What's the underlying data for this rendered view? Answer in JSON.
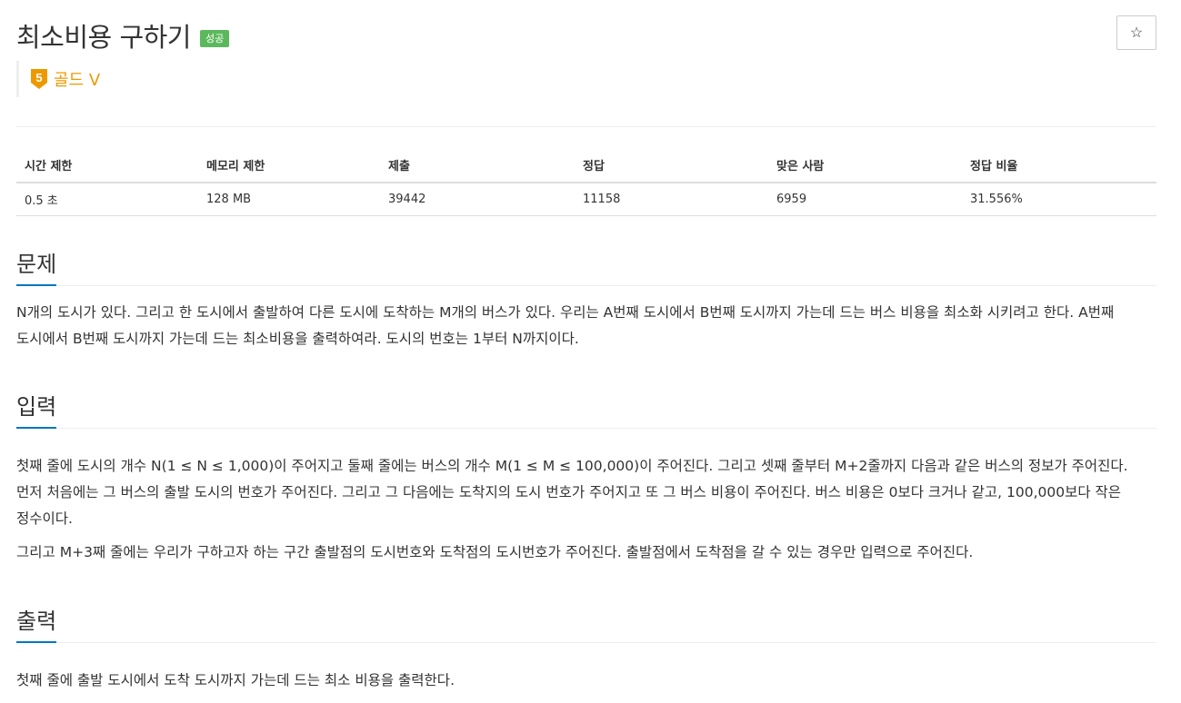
{
  "problem": {
    "title": "최소비용 구하기",
    "status_badge": "성공",
    "star_icon": "☆",
    "tier": {
      "level": "5",
      "label": "골드 V",
      "color": "#ec9a00"
    }
  },
  "info_table": {
    "headers": [
      "시간 제한",
      "메모리 제한",
      "제출",
      "정답",
      "맞은 사람",
      "정답 비율"
    ],
    "values": [
      "0.5 초",
      "128 MB",
      "39442",
      "11158",
      "6959",
      "31.556%"
    ]
  },
  "sections": {
    "description": {
      "title": "문제",
      "paragraphs": [
        "N개의 도시가 있다. 그리고 한 도시에서 출발하여 다른 도시에 도착하는 M개의 버스가 있다. 우리는 A번째 도시에서 B번째 도시까지 가는데 드는 버스 비용을 최소화 시키려고 한다. A번째 도시에서 B번째 도시까지 가는데 드는 최소비용을 출력하여라. 도시의 번호는 1부터 N까지이다."
      ]
    },
    "input": {
      "title": "입력",
      "paragraphs": [
        "첫째 줄에 도시의 개수 N(1 ≤ N ≤ 1,000)이 주어지고 둘째 줄에는 버스의 개수 M(1 ≤ M ≤ 100,000)이 주어진다. 그리고 셋째 줄부터 M+2줄까지 다음과 같은 버스의 정보가 주어진다. 먼저 처음에는 그 버스의 출발 도시의 번호가 주어진다. 그리고 그 다음에는 도착지의 도시 번호가 주어지고 또 그 버스 비용이 주어진다. 버스 비용은 0보다 크거나 같고, 100,000보다 작은 정수이다.",
        "그리고 M+3째 줄에는 우리가 구하고자 하는 구간 출발점의 도시번호와 도착점의 도시번호가 주어진다. 출발점에서 도착점을 갈 수 있는 경우만 입력으로 주어진다."
      ]
    },
    "output": {
      "title": "출력",
      "paragraphs": [
        "첫째 줄에 출발 도시에서 도착 도시까지 가는데 드는 최소 비용을 출력한다."
      ]
    }
  }
}
